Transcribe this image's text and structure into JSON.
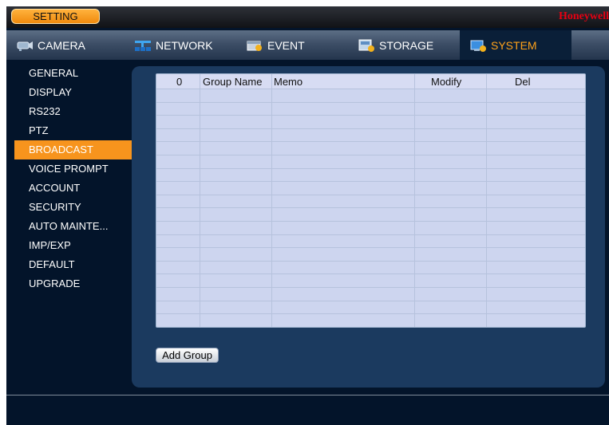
{
  "title_bar": {
    "setting_label": "SETTING",
    "brand": "Honeywell"
  },
  "tabs": [
    {
      "label": "CAMERA",
      "icon": "camera-icon",
      "active": false
    },
    {
      "label": "NETWORK",
      "icon": "network-icon",
      "active": false
    },
    {
      "label": "EVENT",
      "icon": "event-icon",
      "active": false
    },
    {
      "label": "STORAGE",
      "icon": "storage-icon",
      "active": false
    },
    {
      "label": "SYSTEM",
      "icon": "system-icon",
      "active": true
    }
  ],
  "sidebar": {
    "items": [
      {
        "label": "GENERAL",
        "active": false
      },
      {
        "label": "DISPLAY",
        "active": false
      },
      {
        "label": "RS232",
        "active": false
      },
      {
        "label": "PTZ",
        "active": false
      },
      {
        "label": "BROADCAST",
        "active": true
      },
      {
        "label": "VOICE PROMPT",
        "active": false
      },
      {
        "label": "ACCOUNT",
        "active": false
      },
      {
        "label": "SECURITY",
        "active": false
      },
      {
        "label": "AUTO MAINTE...",
        "active": false
      },
      {
        "label": "IMP/EXP",
        "active": false
      },
      {
        "label": "DEFAULT",
        "active": false
      },
      {
        "label": "UPGRADE",
        "active": false
      }
    ]
  },
  "table": {
    "headers": [
      "0",
      "Group Name",
      "Memo",
      "Modify",
      "Del"
    ],
    "empty_rows": 18
  },
  "actions": {
    "add_group_label": "Add Group"
  },
  "colors": {
    "accent": "#f7941d",
    "active_tab_text": "#ffa21a",
    "brand": "#e60012",
    "background": "#03142a",
    "panel": "#1b3a5f",
    "grid": "#cdd5ef"
  }
}
